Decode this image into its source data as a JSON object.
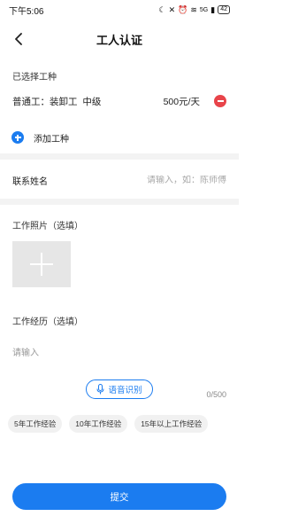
{
  "status_bar": {
    "time": "下午5:06",
    "network": "5G",
    "battery": "42"
  },
  "nav": {
    "title": "工人认证",
    "back_icon": "chevron-left-icon"
  },
  "selected_jobs": {
    "label": "已选择工种",
    "items": [
      {
        "name": "普通工：装卸工  中级",
        "price": "500元/天"
      }
    ],
    "add_label": "添加工种"
  },
  "contact": {
    "label": "联系姓名",
    "placeholder": "请输入，如：陈师傅"
  },
  "photos": {
    "label": "工作照片（选填）"
  },
  "experience": {
    "label": "工作经历（选填）",
    "placeholder": "请输入",
    "voice_button": "语音识别",
    "counter": "0/500",
    "chips": [
      "5年工作经验",
      "10年工作经验",
      "15年以上工作经验"
    ]
  },
  "submit_label": "提交",
  "colors": {
    "accent": "#1b7cf0",
    "danger": "#e8444a"
  }
}
